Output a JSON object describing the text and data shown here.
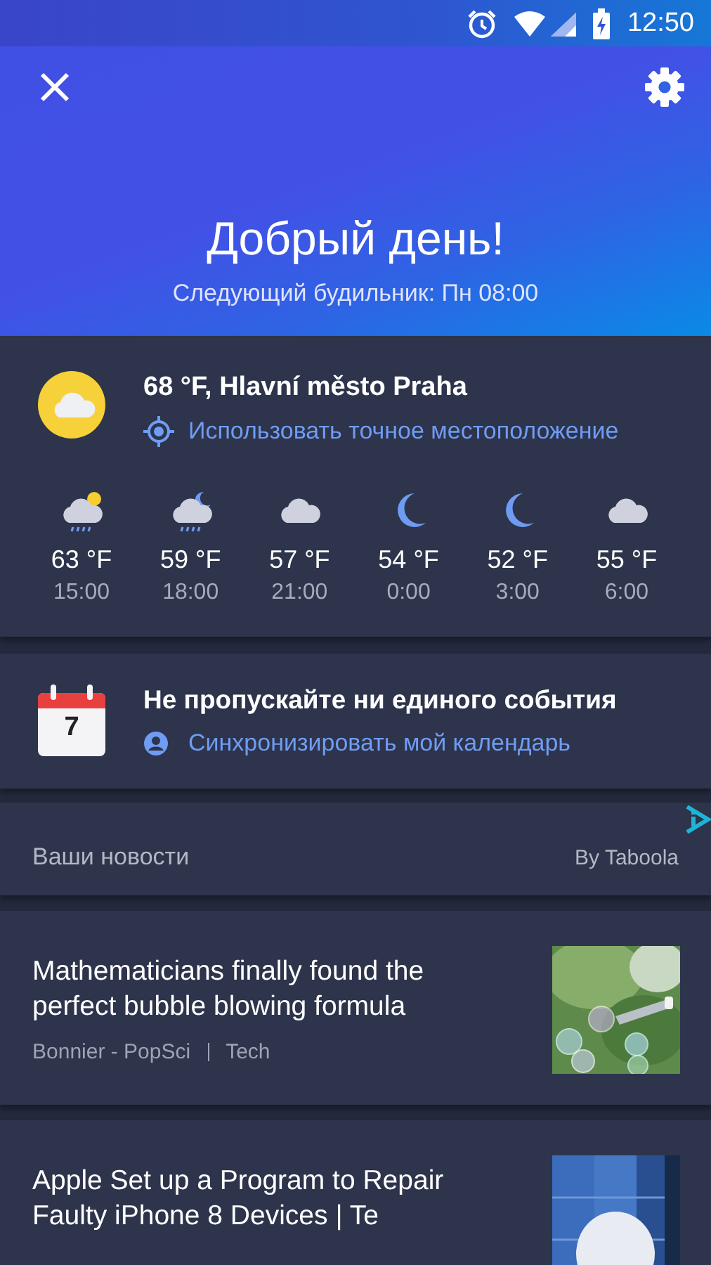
{
  "status_bar": {
    "time": "12:50"
  },
  "header": {
    "greeting": "Добрый день!",
    "next_alarm": "Следующий будильник: Пн 08:00"
  },
  "weather": {
    "current": "68 °F, Hlavní město Praha",
    "location_link": "Использовать точное местоположение",
    "hours": [
      {
        "kind": "rain-sun",
        "temp": "63 °F",
        "time": "15:00"
      },
      {
        "kind": "rain-moon",
        "temp": "59 °F",
        "time": "18:00"
      },
      {
        "kind": "cloud",
        "temp": "57 °F",
        "time": "21:00"
      },
      {
        "kind": "moon",
        "temp": "54 °F",
        "time": "0:00"
      },
      {
        "kind": "moon",
        "temp": "52 °F",
        "time": "3:00"
      },
      {
        "kind": "cloud",
        "temp": "55 °F",
        "time": "6:00"
      }
    ]
  },
  "calendar": {
    "day": "7",
    "title": "Не пропускайте ни единого события",
    "link": "Синхронизировать мой календарь"
  },
  "news": {
    "title": "Ваши новости",
    "provider": "By Taboola",
    "articles": [
      {
        "title": "Mathematicians finally found the perfect bubble blowing formula",
        "source": "Bonnier - PopSci",
        "category": "Tech",
        "image": {
          "kind": "bubbles"
        }
      },
      {
        "title": "Apple Set up a Program to Repair Faulty iPhone 8 Devices | Te",
        "image": {
          "kind": "building"
        }
      }
    ]
  }
}
